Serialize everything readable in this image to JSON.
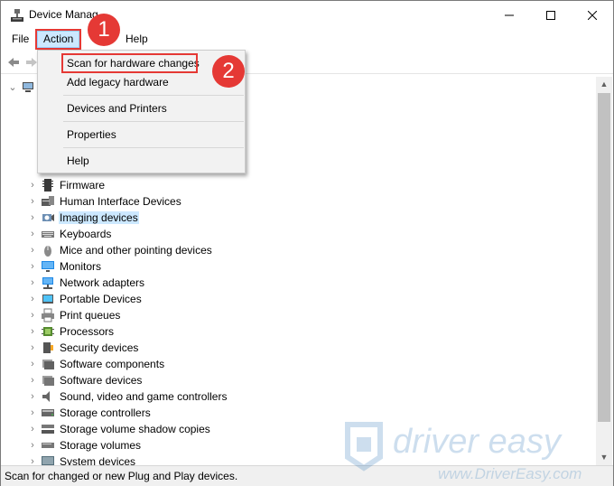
{
  "window": {
    "title": "Device Manager",
    "title_visible": "Device Manag"
  },
  "menubar": {
    "file": "File",
    "action": "Action",
    "help": "Help"
  },
  "context_menu": {
    "items": [
      {
        "label": "Scan for hardware changes"
      },
      {
        "label": "Add legacy hardware"
      },
      {
        "label": "Devices and Printers"
      },
      {
        "label": "Properties"
      },
      {
        "label": "Help"
      }
    ]
  },
  "callouts": {
    "one": "1",
    "two": "2"
  },
  "tree": {
    "rows": [
      {
        "label": "Firmware",
        "icon": "firmware-icon"
      },
      {
        "label": "Human Interface Devices",
        "icon": "hid-icon"
      },
      {
        "label": "Imaging devices",
        "icon": "camera-icon",
        "selected": true
      },
      {
        "label": "Keyboards",
        "icon": "keyboard-icon"
      },
      {
        "label": "Mice and other pointing devices",
        "icon": "mouse-icon"
      },
      {
        "label": "Monitors",
        "icon": "monitor-icon"
      },
      {
        "label": "Network adapters",
        "icon": "network-icon"
      },
      {
        "label": "Portable Devices",
        "icon": "portable-icon"
      },
      {
        "label": "Print queues",
        "icon": "printer-icon"
      },
      {
        "label": "Processors",
        "icon": "cpu-icon"
      },
      {
        "label": "Security devices",
        "icon": "security-icon"
      },
      {
        "label": "Software components",
        "icon": "software-component-icon"
      },
      {
        "label": "Software devices",
        "icon": "software-device-icon"
      },
      {
        "label": "Sound, video and game controllers",
        "icon": "speaker-icon"
      },
      {
        "label": "Storage controllers",
        "icon": "storage-controller-icon"
      },
      {
        "label": "Storage volume shadow copies",
        "icon": "shadow-copy-icon"
      },
      {
        "label": "Storage volumes",
        "icon": "volume-icon"
      },
      {
        "label": "System devices",
        "icon": "system-icon"
      }
    ]
  },
  "status": {
    "text": "Scan for changed or new Plug and Play devices."
  },
  "watermark": {
    "brand": "driver easy",
    "url": "www.DriverEasy.com"
  },
  "colors": {
    "highlight_red": "#e53935",
    "selection_blue": "#cce8ff",
    "menu_bg": "#f2f2f2"
  }
}
